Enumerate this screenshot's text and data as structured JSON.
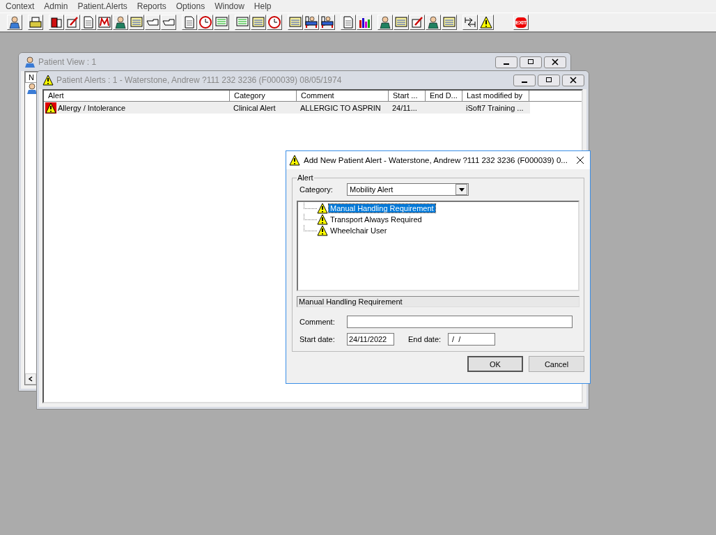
{
  "menu": [
    "Context",
    "Admin",
    "Patient.Alerts",
    "Reports",
    "Options",
    "Window",
    "Help"
  ],
  "toolbar": {
    "exit_label": "EXIT"
  },
  "patient_view": {
    "title": "Patient View : 1",
    "column_1": "N"
  },
  "patient_alerts": {
    "title": "Patient Alerts : 1 - Waterstone, Andrew ?111 232 3236 (F000039) 08/05/1974",
    "columns": [
      "Alert",
      "Category",
      "Comment",
      "Start ...",
      "End D...",
      "Last modified by"
    ],
    "rows": [
      {
        "cells": [
          "Allergy / Intolerance",
          "Clinical Alert",
          "ALLERGIC TO ASPRIN",
          "24/11...",
          "",
          "iSoft7 Training ..."
        ],
        "selected": false
      }
    ]
  },
  "dialog": {
    "title": "Add New Patient Alert - Waterstone, Andrew ?111 232 3236 (F000039) 0...",
    "group_label": "Alert",
    "category_label": "Category:",
    "category_value": "Mobility Alert",
    "alerts": [
      {
        "label": "Manual Handling Requirement",
        "selected": true
      },
      {
        "label": "Transport Always Required",
        "selected": false
      },
      {
        "label": "Wheelchair User",
        "selected": false
      }
    ],
    "selected_text": "Manual Handling Requirement",
    "comment_label": "Comment:",
    "start_label": "Start date:",
    "start_value": "24/11/2022",
    "end_label": "End date:",
    "end_value": " /  /",
    "buttons": [
      "OK",
      "Cancel"
    ]
  }
}
